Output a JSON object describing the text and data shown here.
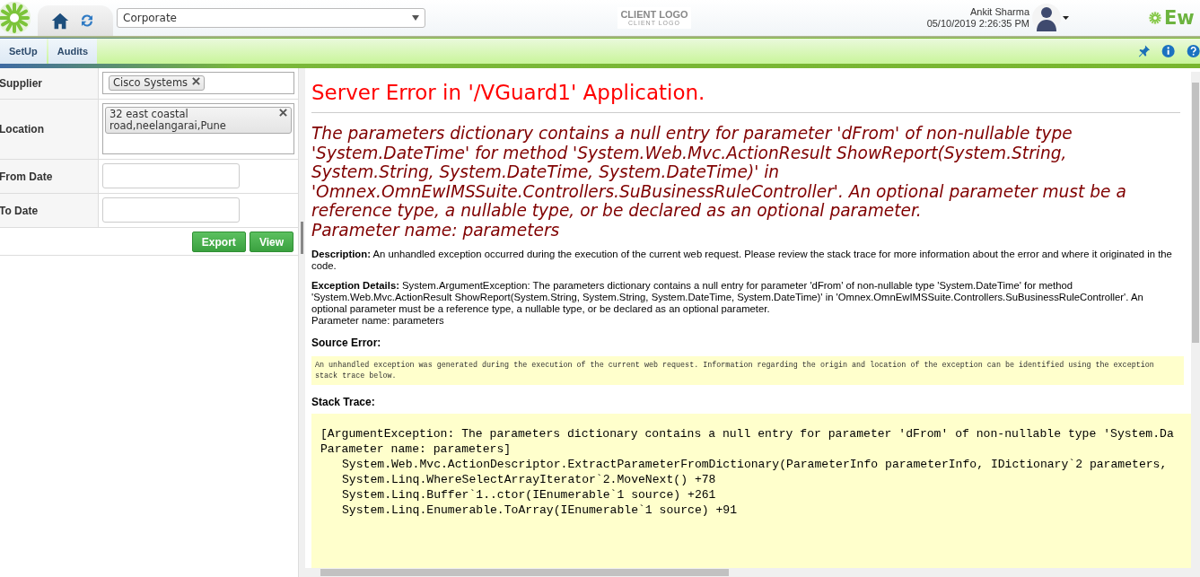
{
  "header": {
    "org_select": "Corporate",
    "client_logo": {
      "title": "CLIENT LOGO",
      "subtitle": "CLIENT LOGO"
    },
    "user": {
      "name": "Ankit Sharma",
      "datetime": "05/10/2019 2:26:35 PM"
    },
    "brand": "Ew"
  },
  "nav": {
    "tabs": [
      {
        "label": "SetUp",
        "selected": false
      },
      {
        "label": "Audits",
        "selected": false
      }
    ]
  },
  "filters": {
    "fields": [
      {
        "kind": "tags",
        "label": "Supplier",
        "tags": [
          "Cisco Systems"
        ]
      },
      {
        "kind": "tagarea",
        "label": "Location",
        "tags": [
          "32 east coastal road,neelangarai,Pune"
        ]
      },
      {
        "kind": "date",
        "label": "From Date"
      },
      {
        "kind": "date",
        "label": "To Date"
      }
    ],
    "buttons": [
      "Export",
      "View"
    ]
  },
  "error": {
    "title": "Server Error in '/VGuard1' Application.",
    "message": "The parameters dictionary contains a null entry for parameter 'dFrom' of non-nullable type 'System.DateTime' for method 'System.Web.Mvc.ActionResult ShowReport(System.String, System.String, System.DateTime, System.DateTime)' in 'Omnex.OmnEwIMSSuite.Controllers.SuBusinessRuleController'. An optional parameter must be a reference type, a nullable type, or be declared as an optional parameter.\nParameter name: parameters",
    "description": "**Description:** An unhandled exception occurred during the execution of the current web request. Please review the stack trace for more information about the error and where it originated in the code.",
    "exception_details": "**Exception Details:** System.ArgumentException: The parameters dictionary contains a null entry for parameter 'dFrom' of non-nullable type 'System.DateTime' for method 'System.Web.Mvc.ActionResult ShowReport(System.String, System.String, System.DateTime, System.DateTime)' in 'Omnex.OmnEwIMSSuite.Controllers.SuBusinessRuleController'. An optional parameter must be a reference type, a nullable type, or be declared as an optional parameter.\nParameter name: parameters",
    "source_heading": "Source Error:",
    "source_text": "An unhandled exception was generated during the execution of the current web request. Information regarding the origin and location of the exception can be identified using the exception stack trace below.",
    "stack_heading": "Stack Trace:",
    "stack": [
      {
        "kind": "message",
        "text": "[ArgumentException: The parameters dictionary contains a null entry for parameter 'dFrom' of non-nullable type 'System.Da"
      },
      {
        "kind": "message",
        "text": "Parameter name: parameters]"
      },
      {
        "kind": "frame",
        "text": "System.Web.Mvc.ActionDescriptor.ExtractParameterFromDictionary(ParameterInfo parameterInfo, IDictionary`2 parameters,"
      },
      {
        "kind": "frame",
        "text": "System.Linq.WhereSelectArrayIterator`2.MoveNext() +78"
      },
      {
        "kind": "frame",
        "text": "System.Linq.Buffer`1..ctor(IEnumerable`1 source) +261"
      },
      {
        "kind": "frame",
        "text": "System.Linq.Enumerable.ToArray(IEnumerable`1 source) +91"
      }
    ]
  }
}
